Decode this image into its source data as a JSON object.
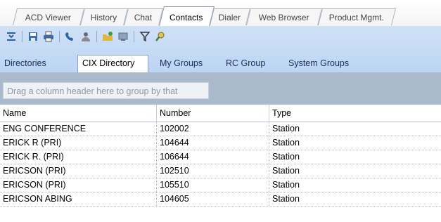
{
  "tabs": [
    {
      "label": "ACD Viewer"
    },
    {
      "label": "History"
    },
    {
      "label": "Chat"
    },
    {
      "label": "Contacts"
    },
    {
      "label": "Dialer"
    },
    {
      "label": "Web Browser"
    },
    {
      "label": "Product Mgmt."
    }
  ],
  "active_tab": "Contacts",
  "toolbar": {
    "icons": [
      "collapse-icon",
      "save-icon",
      "print-icon",
      "phone-icon",
      "user-icon",
      "new-folder-icon",
      "properties-icon",
      "filter-icon",
      "search-person-icon"
    ]
  },
  "subtabs": [
    {
      "label": "Directories"
    },
    {
      "label": "CIX Directory"
    },
    {
      "label": "My Groups"
    },
    {
      "label": "RC Group"
    },
    {
      "label": "System Groups"
    }
  ],
  "active_subtab": "CIX Directory",
  "grid": {
    "group_hint": "Drag a column header here to group by that column.",
    "columns": [
      "Name",
      "Number",
      "Type"
    ],
    "rows": [
      [
        "ENG CONFERENCE",
        "102002",
        "Station"
      ],
      [
        "ERICK R (PRI)",
        "104644",
        "Station"
      ],
      [
        "ERICK R. (PRI)",
        "106644",
        "Station"
      ],
      [
        "ERICSON (PRI)",
        "102510",
        "Station"
      ],
      [
        "ERICSON (PRI)",
        "105510",
        "Station"
      ],
      [
        "ERICSON ABING",
        "104605",
        "Station"
      ]
    ]
  },
  "colors": {
    "ribbon": "#c4daf5",
    "group_bar": "#aab9cc",
    "link": "#1a2e56"
  }
}
